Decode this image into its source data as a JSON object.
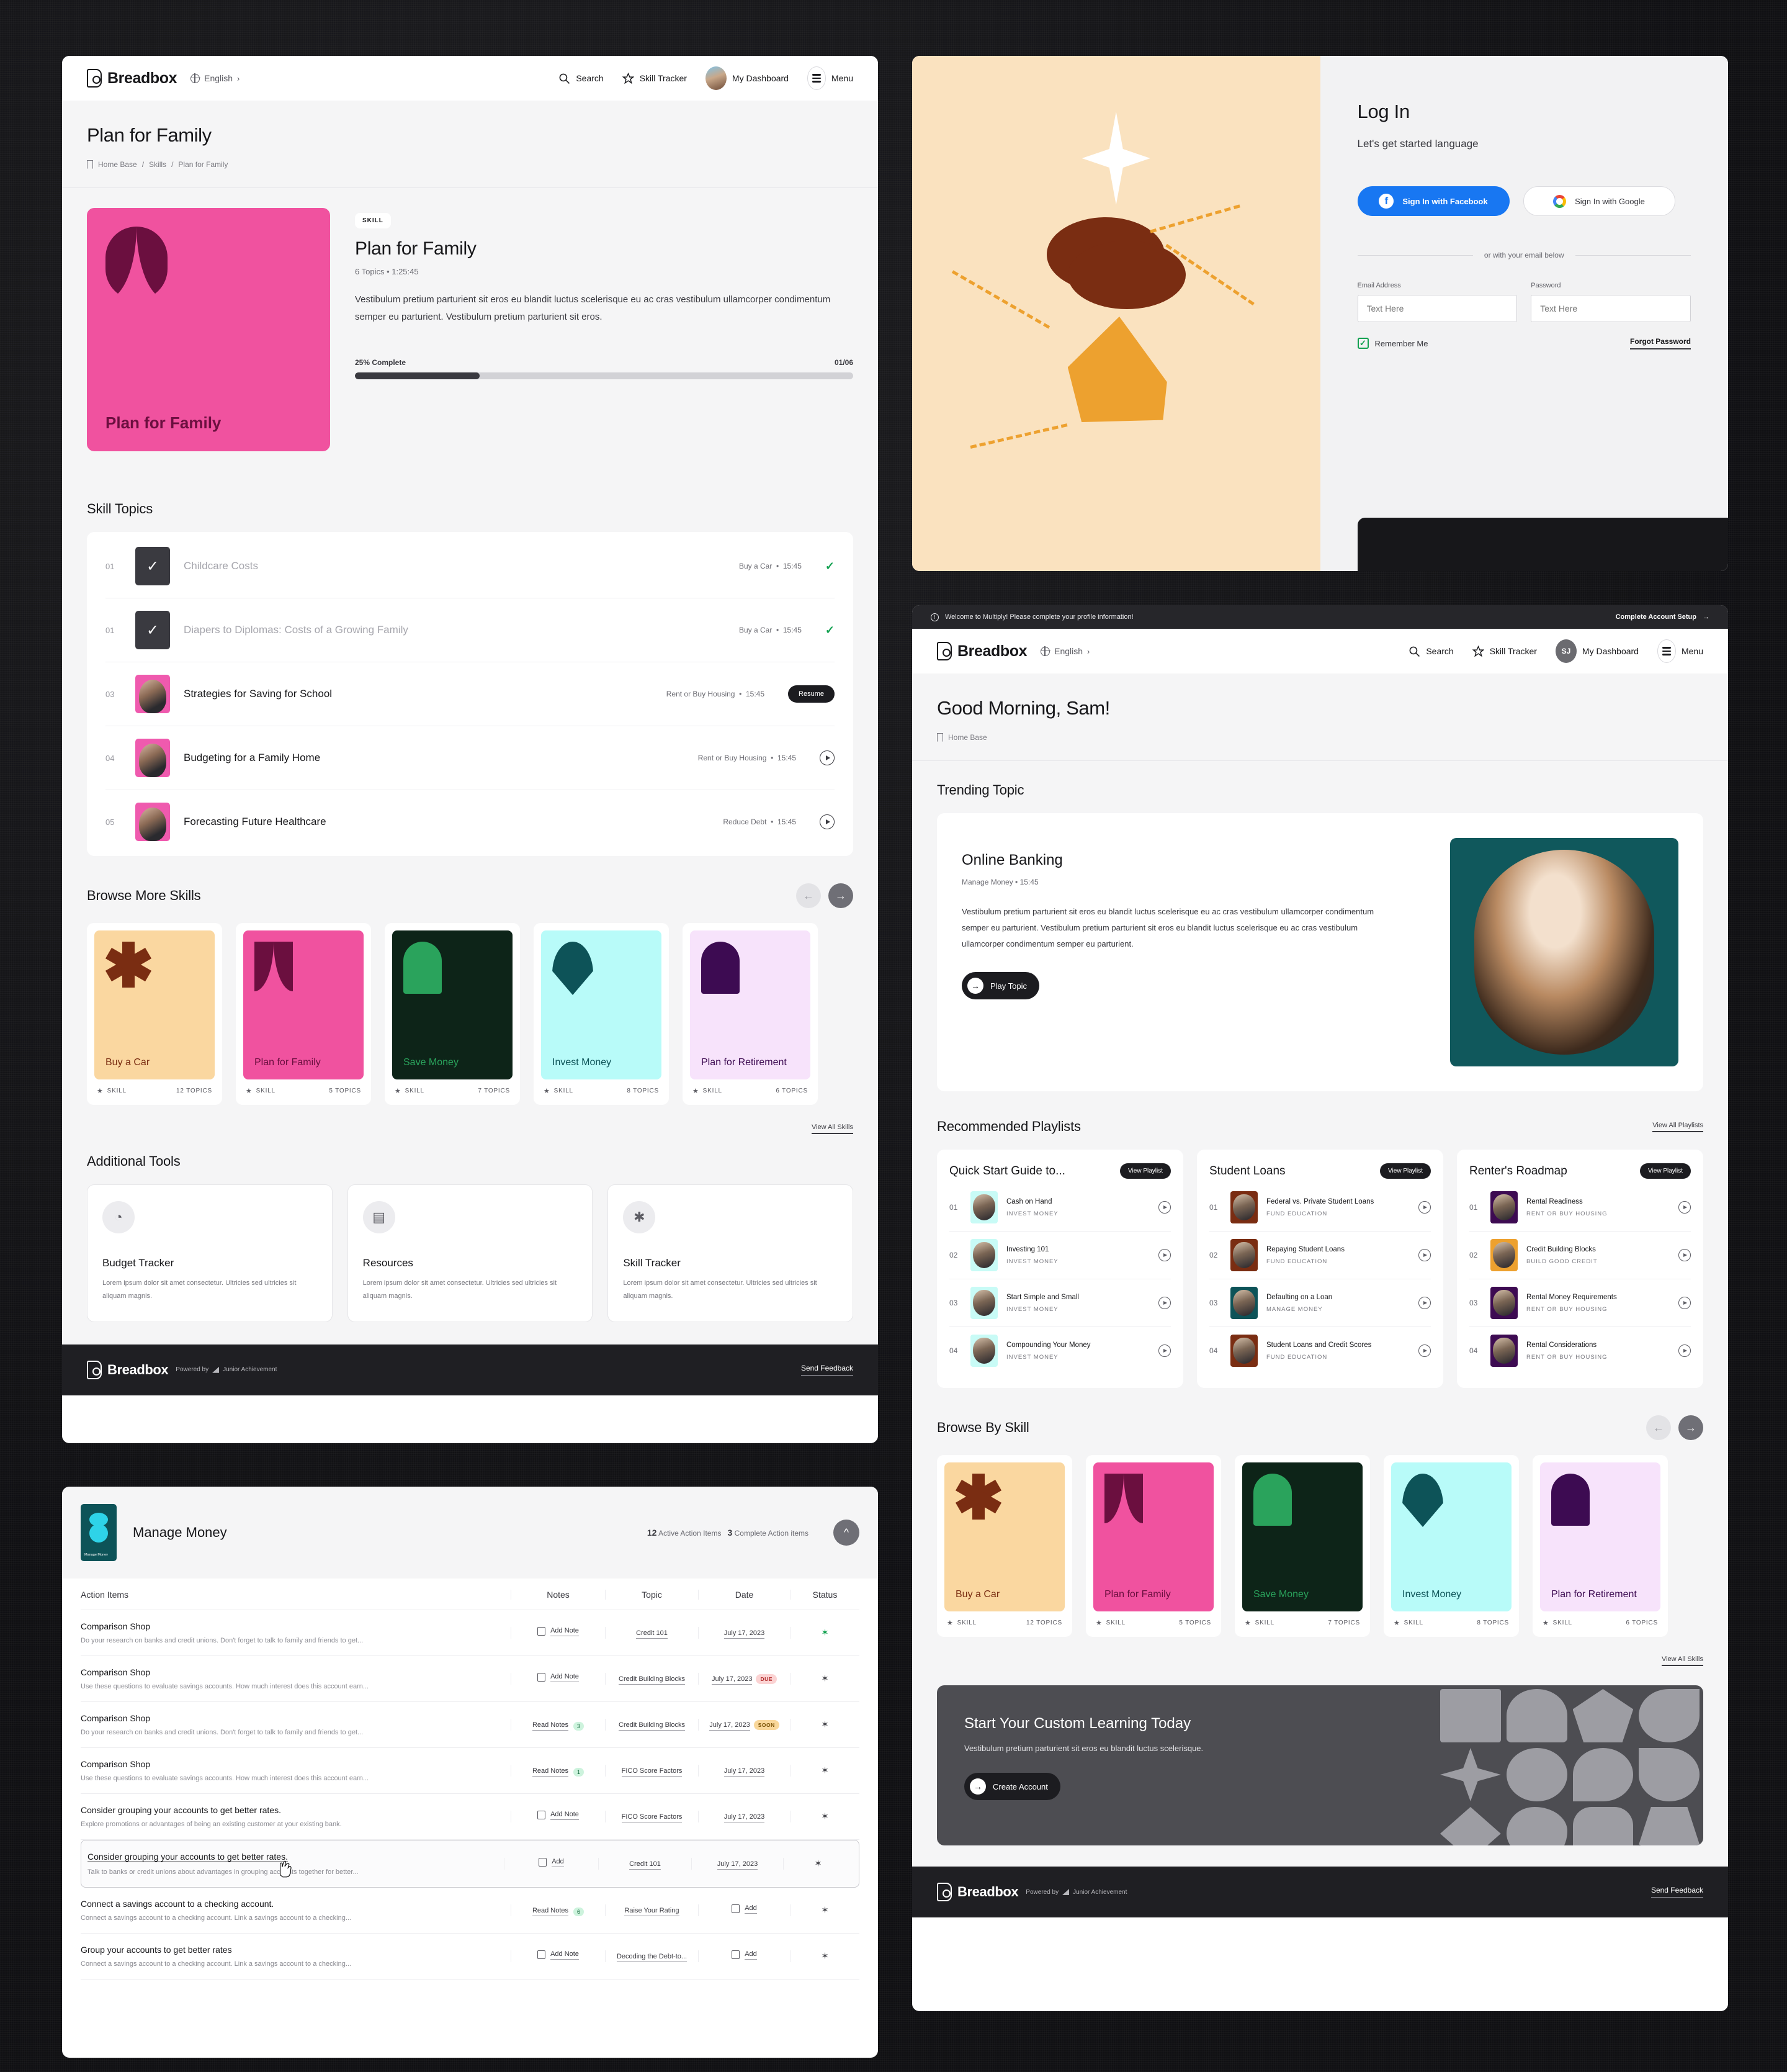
{
  "brand": {
    "name": "Breadbox",
    "lang": "English",
    "powered_by": "Powered by",
    "partner": "Junior Achievement",
    "send_feedback": "Send Feedback"
  },
  "nav": {
    "search": "Search",
    "skill_tracker": "Skill Tracker",
    "dashboard": "My Dashboard",
    "menu": "Menu",
    "avatar_initials": "SJ"
  },
  "skill_page": {
    "title": "Plan for Family",
    "breadcrumbs": [
      "Home Base",
      "Skills",
      "Plan for Family"
    ],
    "card_label": "Plan for Family",
    "card_bg": "#f0529f",
    "card_fg": "#6b0f3f",
    "pill": "SKILL",
    "name": "Plan for Family",
    "meta": "6 Topics  •  1:25:45",
    "description": "Vestibulum pretium parturient sit eros eu blandit luctus scelerisque eu ac cras vestibulum ullamcorper condimentum semper eu parturient. Vestibulum pretium parturient sit eros.",
    "progress_label": "25% Complete",
    "progress_count": "01/06",
    "progress_percent": 25,
    "topics_title": "Skill Topics",
    "topics": [
      {
        "num": "01",
        "title": "Childcare Costs",
        "topic": "Buy a Car",
        "time": "15:45",
        "state": "done"
      },
      {
        "num": "01",
        "title": "Diapers to Diplomas: Costs of a Growing Family",
        "topic": "Buy a Car",
        "time": "15:45",
        "state": "done"
      },
      {
        "num": "03",
        "title": "Strategies for Saving for School",
        "topic": "Rent or Buy Housing",
        "time": "15:45",
        "state": "resume",
        "action": "Resume"
      },
      {
        "num": "04",
        "title": "Budgeting for a Family Home",
        "topic": "Rent or Buy Housing",
        "time": "15:45",
        "state": "play"
      },
      {
        "num": "05",
        "title": "Forecasting Future Healthcare",
        "topic": "Reduce Debt",
        "time": "15:45",
        "state": "play"
      }
    ],
    "browse_title": "Browse More Skills",
    "view_all_skills": "View All Skills",
    "tools_title": "Additional Tools",
    "tools": [
      {
        "icon": "piggy-bank-icon",
        "glyph": "◔",
        "title": "Budget Tracker",
        "desc": "Lorem ipsum dolor sit amet consectetur. Ultricies sed ultricies sit aliquam magnis."
      },
      {
        "icon": "document-icon",
        "glyph": "▤",
        "title": "Resources",
        "desc": "Lorem ipsum dolor sit amet consectetur. Ultricies sed ultricies sit aliquam magnis."
      },
      {
        "icon": "asterisk-icon",
        "glyph": "✱",
        "title": "Skill Tracker",
        "desc": "Lorem ipsum dolor sit amet consectetur. Ultricies sed ultricies sit aliquam magnis."
      }
    ]
  },
  "skills": [
    {
      "name": "Buy a Car",
      "topics": "12 TOPICS",
      "kind": "SKILL",
      "bg": "#fad7a0",
      "fg": "#7a2d12",
      "glyph": "asterisk"
    },
    {
      "name": "Plan for Family",
      "topics": "5 TOPICS",
      "kind": "SKILL",
      "bg": "#f0529f",
      "fg": "#6b0f3f",
      "glyph": "tulip"
    },
    {
      "name": "Save Money",
      "topics": "7 TOPICS",
      "kind": "SKILL",
      "bg": "#0d2418",
      "fg": "#2aa35c",
      "glyph": "arch"
    },
    {
      "name": "Invest Money",
      "topics": "8 TOPICS",
      "kind": "SKILL",
      "bg": "#b8fbf9",
      "fg": "#0d5358",
      "glyph": "drop"
    },
    {
      "name": "Plan for Retirement",
      "topics": "6 TOPICS",
      "kind": "SKILL",
      "bg": "#f7e3fb",
      "fg": "#3d0b52",
      "glyph": "arch"
    }
  ],
  "login": {
    "title": "Log In",
    "subtitle": "Let's get started language",
    "facebook": "Sign In with Facebook",
    "google": "Sign In with Google",
    "divider": "or with your email below",
    "email_label": "Email Address",
    "email_placeholder": "Text Here",
    "password_label": "Password",
    "password_placeholder": "Text Here",
    "remember": "Remember Me",
    "forgot": "Forgot Password"
  },
  "dashboard": {
    "banner_text": "Welcome to Multiply! Please complete your profile information!",
    "banner_cta": "Complete Account Setup",
    "greeting": "Good Morning, Sam!",
    "breadcrumb": "Home Base",
    "trending_title": "Trending Topic",
    "trending": {
      "name": "Online Banking",
      "meta": "Manage Money  •  15:45",
      "desc": "Vestibulum pretium parturient sit eros eu blandit luctus scelerisque eu ac cras vestibulum ullamcorper condimentum semper eu parturient. Vestibulum pretium parturient sit eros eu blandit luctus scelerisque eu ac cras vestibulum ullamcorper condimentum semper eu parturient.",
      "cta": "Play Topic"
    },
    "playlists_title": "Recommended Playlists",
    "view_all_playlists": "View All Playlists",
    "view_playlist": "View Playlist",
    "playlists": [
      {
        "name": "Quick Start Guide to...",
        "thumb_bg": "#c8fbf6",
        "items": [
          {
            "n": "01",
            "t": "Cash on Hand",
            "c": "INVEST MONEY"
          },
          {
            "n": "02",
            "t": "Investing 101",
            "c": "INVEST MONEY"
          },
          {
            "n": "03",
            "t": "Start Simple and Small",
            "c": "INVEST MONEY"
          },
          {
            "n": "04",
            "t": "Compounding Your Money",
            "c": "INVEST MONEY"
          }
        ]
      },
      {
        "name": "Student Loans",
        "thumb_bg": "#7a2d12",
        "items": [
          {
            "n": "01",
            "t": "Federal vs. Private Student Loans",
            "c": "FUND EDUCATION"
          },
          {
            "n": "02",
            "t": "Repaying Student Loans",
            "c": "FUND EDUCATION"
          },
          {
            "n": "03",
            "t": "Defaulting on a Loan",
            "c": "MANAGE MONEY",
            "thumb_bg": "#0d5358"
          },
          {
            "n": "04",
            "t": "Student Loans and Credit Scores",
            "c": "FUND EDUCATION"
          }
        ]
      },
      {
        "name": "Renter's Roadmap",
        "thumb_bg": "#3d0b52",
        "items": [
          {
            "n": "01",
            "t": "Rental Readiness",
            "c": "RENT OR BUY HOUSING"
          },
          {
            "n": "02",
            "t": "Credit Building Blocks",
            "c": "BUILD GOOD CREDIT",
            "thumb_bg": "#eda12f"
          },
          {
            "n": "03",
            "t": "Rental Money Requirements",
            "c": "RENT OR BUY HOUSING"
          },
          {
            "n": "04",
            "t": "Rental Considerations",
            "c": "RENT OR BUY HOUSING"
          }
        ]
      }
    ],
    "browse_title": "Browse By Skill",
    "view_all_skills": "View All Skills",
    "cta": {
      "title": "Start Your Custom Learning Today",
      "desc": "Vestibulum pretium parturient sit eros eu blandit luctus scelerisque.",
      "button": "Create Account"
    }
  },
  "action_items": {
    "skill": "Manage Money",
    "thumb_label": "Manage Money",
    "active_count": "12",
    "active_label": "Active Action Items",
    "complete_count": "3",
    "complete_label": "Complete Action items",
    "columns": [
      "Action Items",
      "Notes",
      "Topic",
      "Date",
      "Status"
    ],
    "rows": [
      {
        "title": "Comparison Shop",
        "desc": "Do your research on banks and credit unions. Don't forget to talk to family and friends to get...",
        "notes": "Add Note",
        "notes_kind": "add",
        "topic": "Credit 101",
        "date": "July 17, 2023",
        "tag": "",
        "status_green": true
      },
      {
        "title": "Comparison Shop",
        "desc": "Use these questions to evaluate savings accounts. How much interest does this account earn...",
        "notes": "Add Note",
        "notes_kind": "add",
        "topic": "Credit Building Blocks",
        "date": "July 17, 2023",
        "tag": "DUE",
        "tag_kind": "due"
      },
      {
        "title": "Comparison Shop",
        "desc": "Do your research on banks and credit unions. Don't forget to talk to family and friends to get...",
        "notes": "Read Notes",
        "notes_kind": "read",
        "notes_count": "3",
        "topic": "Credit Building Blocks",
        "date": "July 17, 2023",
        "tag": "SOON",
        "tag_kind": "soon"
      },
      {
        "title": "Comparison Shop",
        "desc": "Use these questions to evaluate savings accounts. How much interest does this account earn...",
        "notes": "Read Notes",
        "notes_kind": "read",
        "notes_count": "1",
        "topic": "FICO Score Factors",
        "date": "July 17, 2023",
        "tag": ""
      },
      {
        "title": "Consider grouping your accounts to get better rates.",
        "desc": "Explore promotions or advantages of being an existing customer at your existing bank.",
        "notes": "Add Note",
        "notes_kind": "add",
        "topic": "FICO Score Factors",
        "date": "July 17, 2023",
        "tag": ""
      },
      {
        "title": "Consider grouping your accounts to get better rates.",
        "desc": "Talk to banks or credit unions about advantages in grouping accounts together for better...",
        "notes": "Add",
        "notes_kind": "addcal",
        "topic": "Credit 101",
        "date": "July 17, 2023",
        "tag": "",
        "selected": true
      },
      {
        "title": "Connect a savings account to a checking account.",
        "desc": "Connect a savings account to a checking account. Link a savings account to a checking...",
        "notes": "Read Notes",
        "notes_kind": "read",
        "notes_count": "6",
        "topic": "Raise Your Rating",
        "date": "Add",
        "date_kind": "addcal",
        "tag": ""
      },
      {
        "title": "Group your accounts to get better rates",
        "desc": "Connect a savings account to a checking account. Link a savings account to a checking...",
        "notes": "Add Note",
        "notes_kind": "add",
        "topic": "Decoding the Debt-to...",
        "date": "Add",
        "date_kind": "addcal",
        "tag": ""
      }
    ]
  }
}
